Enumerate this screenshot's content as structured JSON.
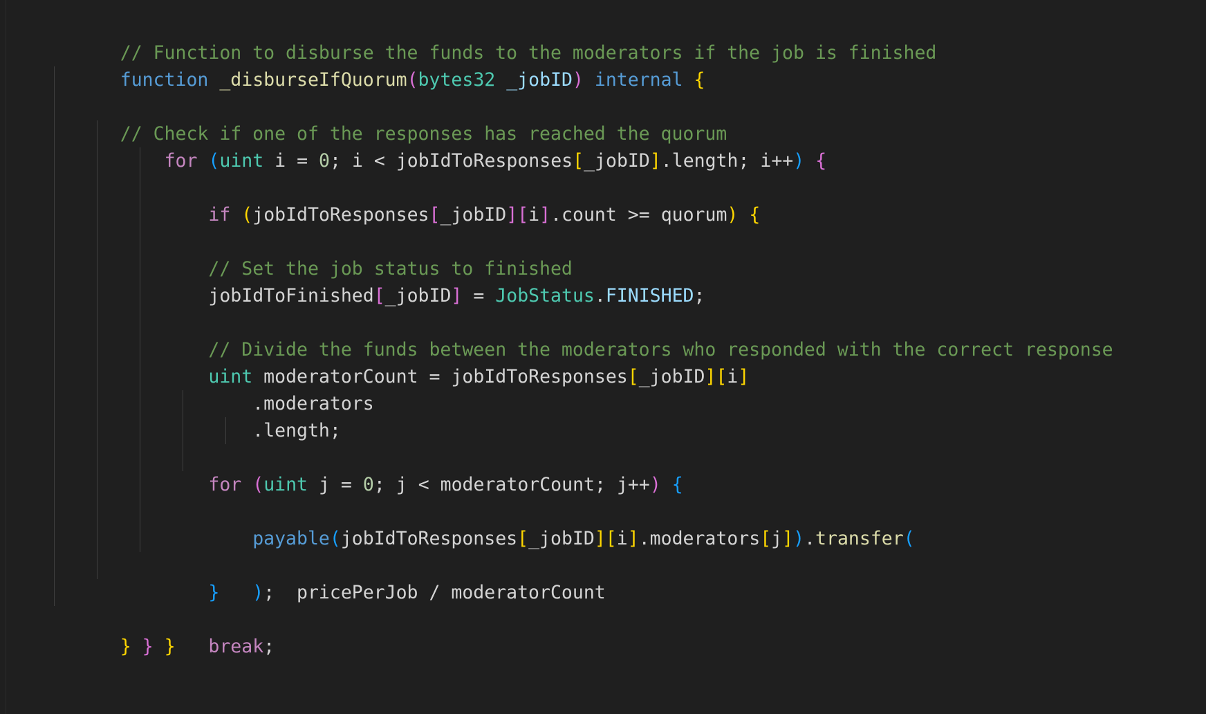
{
  "editor": {
    "language": "solidity",
    "theme": "dark-plus",
    "background": "#1f1f1f",
    "foreground": "#d4d4d4",
    "font_size_px": 26.5,
    "line_height_px": 39,
    "colors": {
      "comment": "#6a9955",
      "keyword": "#569cd6",
      "control": "#c586c0",
      "function": "#dcdcaa",
      "type": "#4ec9b0",
      "variable": "#9cdcfe",
      "number": "#b5cea8",
      "plain": "#d4d4d4",
      "bracket_level1": "#ffd700",
      "bracket_level2": "#da70d6",
      "bracket_level3": "#179fff",
      "indent_guide": "#404040"
    }
  },
  "code": {
    "lines": [
      "// Function to disburse the funds to the moderators if the job is finished",
      "function _disburseIfQuorum(bytes32 _jobID) internal {",
      "    // Check if one of the responses has reached the quorum",
      "    for (uint i = 0; i < jobIdToResponses[_jobID].length; i++) {",
      "        if (jobIdToResponses[_jobID][i].count >= quorum) {",
      "            // Set the job status to finished",
      "            jobIdToFinished[_jobID] = JobStatus.FINISHED;",
      "",
      "            // Divide the funds between the moderators who responded with the correct response",
      "            uint moderatorCount = jobIdToResponses[_jobID][i]",
      "                .moderators",
      "                .length;",
      "",
      "            for (uint j = 0; j < moderatorCount; j++) {",
      "                payable(jobIdToResponses[_jobID][i].moderators[j]).transfer(",
      "                    pricePerJob / moderatorCount",
      "                );",
      "            }",
      "",
      "            break;",
      "        }",
      "    }",
      "}"
    ],
    "symbols": {
      "function_name": "_disburseIfQuorum",
      "parameter": "_jobID",
      "parameter_type": "bytes32",
      "visibility": "internal",
      "mappings": [
        "jobIdToResponses",
        "jobIdToFinished"
      ],
      "enum": "JobStatus",
      "enum_member": "FINISHED",
      "state_vars": [
        "quorum",
        "pricePerJob"
      ],
      "locals": [
        "i",
        "j",
        "moderatorCount"
      ],
      "members": [
        "length",
        "count",
        "moderators",
        "transfer"
      ],
      "builtins": [
        "payable"
      ]
    },
    "comments": [
      "// Function to disburse the funds to the moderators if the job is finished",
      "// Check if one of the responses has reached the quorum",
      "// Set the job status to finished",
      "// Divide the funds between the moderators who responded with the correct response"
    ]
  }
}
